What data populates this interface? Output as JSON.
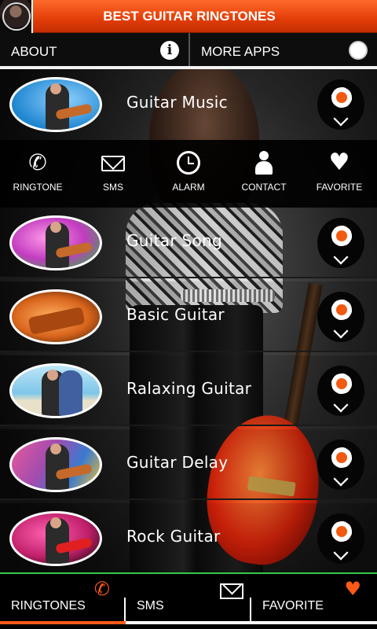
{
  "header": {
    "title": "BEST GUITAR RINGTONES",
    "accent_color": "#e8420a"
  },
  "subbar": {
    "about_label": "ABOUT",
    "more_apps_label": "MORE APPS",
    "info_glyph": "i"
  },
  "list": {
    "items": [
      {
        "label": "Guitar Music",
        "thumb_bg": "#1f86d0"
      },
      {
        "label": "Guitar Song",
        "thumb_bg": "#c23cc0"
      },
      {
        "label": "Basic Guitar",
        "thumb_bg": "#d8641c"
      },
      {
        "label": "Ralaxing Guitar",
        "thumb_bg": "#7ec6e8"
      },
      {
        "label": "Guitar Delay",
        "thumb_bg": "#a04cb0"
      },
      {
        "label": "Rock Guitar",
        "thumb_bg": "#c0206a"
      }
    ]
  },
  "actions": [
    {
      "label": "RINGTONE",
      "icon": "phone-icon"
    },
    {
      "label": "SMS",
      "icon": "mail-icon"
    },
    {
      "label": "ALARM",
      "icon": "alarm-icon"
    },
    {
      "label": "CONTACT",
      "icon": "contact-icon"
    },
    {
      "label": "FAVORITE",
      "icon": "heart-icon"
    }
  ],
  "tabs": [
    {
      "label": "RINGTONES",
      "icon": "phone-icon",
      "active": true
    },
    {
      "label": "SMS",
      "icon": "mail-icon",
      "active": false
    },
    {
      "label": "FAVORITE",
      "icon": "heart-icon",
      "active": false
    }
  ],
  "colors": {
    "tab_active": "#ff5a1a",
    "tab_border": "#2ecc4a"
  }
}
